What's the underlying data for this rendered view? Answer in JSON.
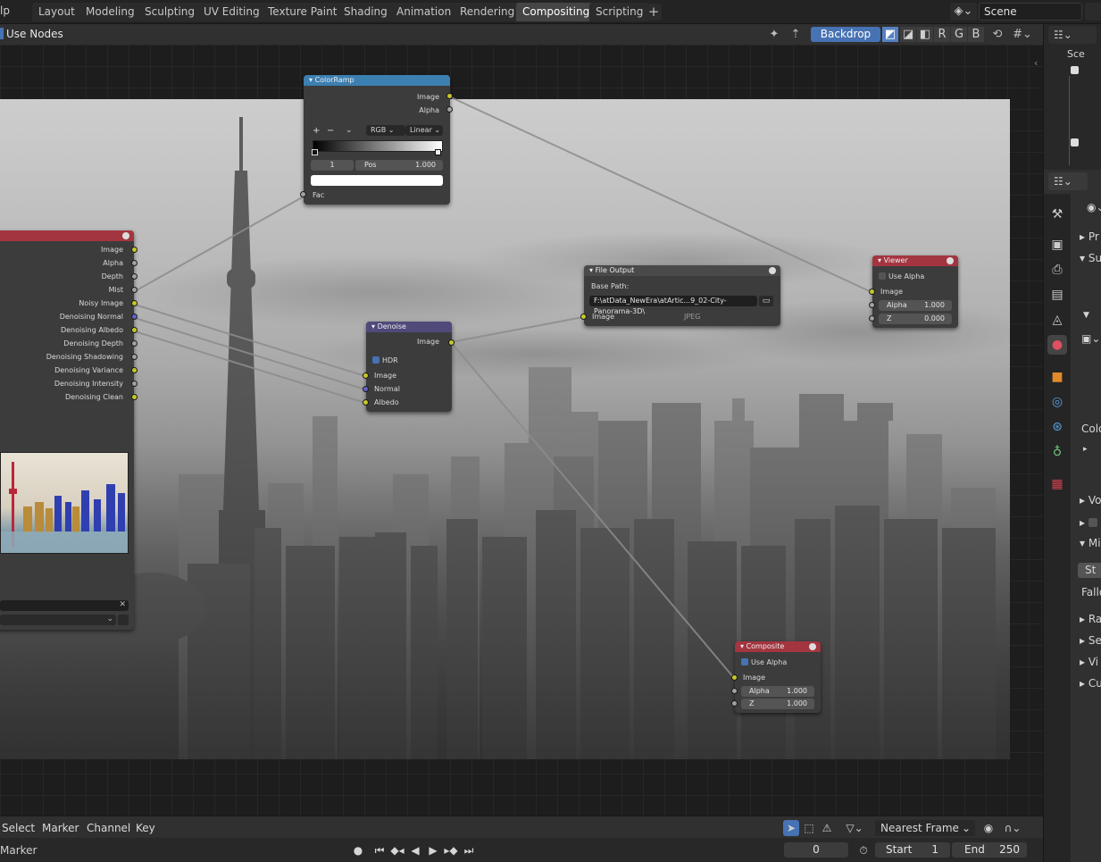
{
  "topbar": {
    "menu_fragment": "lp",
    "tabs": [
      "Layout",
      "Modeling",
      "Sculpting",
      "UV Editing",
      "Texture Paint",
      "Shading",
      "Animation",
      "Rendering",
      "Compositing",
      "Scripting"
    ],
    "active_tab": "Compositing",
    "add_tab": "+",
    "scene_name": "Scene"
  },
  "node_header": {
    "use_nodes_label": "Use Nodes",
    "backdrop_label": "Backdrop",
    "channels": [
      "R",
      "G",
      "B"
    ]
  },
  "nodes": {
    "colorramp": {
      "title": "ColorRamp",
      "out_image": "Image",
      "out_alpha": "Alpha",
      "add": "+",
      "remove": "−",
      "mode": "RGB",
      "interpolation": "Linear",
      "stop_index": "1",
      "pos_label": "Pos",
      "pos_value": "1.000",
      "in_fac": "Fac"
    },
    "render_layers": {
      "outputs": [
        "Image",
        "Alpha",
        "Depth",
        "Mist",
        "Noisy Image",
        "Denoising Normal",
        "Denoising Albedo",
        "Denoising Depth",
        "Denoising Shadowing",
        "Denoising Variance",
        "Denoising Intensity",
        "Denoising Clean"
      ]
    },
    "denoise": {
      "title": "Denoise",
      "out_image": "Image",
      "hdr_label": "HDR",
      "in_image": "Image",
      "in_normal": "Normal",
      "in_albedo": "Albedo"
    },
    "file_output": {
      "title": "File Output",
      "base_path_label": "Base Path:",
      "base_path": "F:\\atData_NewEra\\atArtic...9_02-City-Panorama-3D\\",
      "in_image": "Image",
      "format": "JPEG"
    },
    "viewer": {
      "title": "Viewer",
      "use_alpha_label": "Use Alpha",
      "in_image": "Image",
      "alpha_label": "Alpha",
      "alpha_value": "1.000",
      "z_label": "Z",
      "z_value": "0.000"
    },
    "composite": {
      "title": "Composite",
      "use_alpha_label": "Use Alpha",
      "in_image": "Image",
      "alpha_label": "Alpha",
      "alpha_value": "1.000",
      "z_label": "Z",
      "z_value": "1.000"
    }
  },
  "timeline": {
    "menus": [
      "Select",
      "Marker",
      "Channel",
      "Key"
    ],
    "snap_mode": "Nearest Frame",
    "marker_label": "Marker",
    "current_frame": "0",
    "start_label": "Start",
    "start_value": "1",
    "end_label": "End",
    "end_value": "250"
  },
  "outliner": {
    "scene_label": "Sce"
  },
  "properties": {
    "cut_labels": [
      "Pr",
      "Su",
      "Colo",
      "Vo",
      "Mi",
      "St",
      "Fallo",
      "Ra",
      "Se",
      "Vi",
      "Cu"
    ]
  },
  "colors": {
    "accent_blue": "#4772b3",
    "socket_yellow": "#c7c729",
    "socket_gray": "#a1a1a1",
    "socket_blue": "#6363c7",
    "colorramp_header": "#3c7fb1",
    "output_header": "#a33540",
    "filter_header": "#4f4a7a"
  }
}
